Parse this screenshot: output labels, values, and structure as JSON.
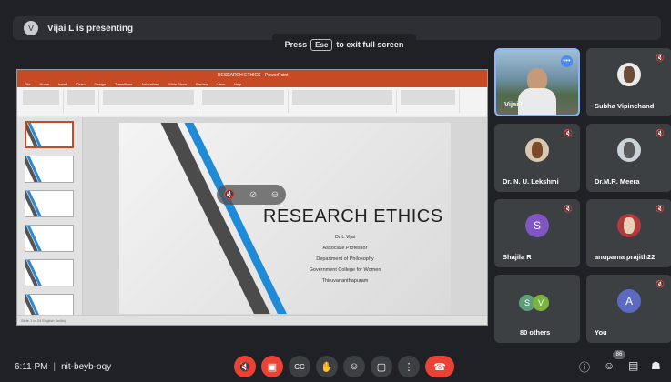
{
  "topbar": {
    "presenter_initial": "V",
    "presenting_text": "Vijai L is presenting"
  },
  "esc_banner": {
    "pre": "Press",
    "key": "Esc",
    "post": "to exit full screen"
  },
  "ppt": {
    "doc_title": "RESEARCH ETHICS - PowerPoint",
    "tabs": [
      "File",
      "Home",
      "Insert",
      "Draw",
      "Design",
      "Transitions",
      "Animations",
      "Slide Show",
      "Review",
      "View",
      "Help"
    ],
    "slide_title": "RESEARCH ETHICS",
    "slide_info": [
      "Dr L Vijai",
      "Associate Professor",
      "Department of Philosophy",
      "Government College for Women",
      "Thiruvananthapuram"
    ],
    "status_text": "Slide 1 of 24    English (India)"
  },
  "participants": [
    {
      "name": "Vijai L",
      "type": "video"
    },
    {
      "name": "Subha Vipinchand",
      "type": "photo"
    },
    {
      "name": "Dr. N. U. Lekshmi",
      "type": "photo"
    },
    {
      "name": "Dr.M.R. Meera",
      "type": "photo"
    },
    {
      "name": "Shajila R",
      "type": "letter",
      "initial": "S",
      "color": "#7e57c2"
    },
    {
      "name": "anupama prajith22",
      "type": "photo"
    },
    {
      "name": "80 others",
      "type": "others",
      "initials": [
        "S",
        "V"
      ]
    },
    {
      "name": "You",
      "type": "letter",
      "initial": "A",
      "color": "#5c6bc0"
    }
  ],
  "bottombar": {
    "time": "6:11 PM",
    "meeting_code": "nit-beyb-oqy",
    "participant_count": "86"
  },
  "icons": {
    "mic_off": "mic-off-icon",
    "cam_off": "camera-off-icon",
    "cc": "captions-icon",
    "hand": "raise-hand-icon",
    "emoji": "emoji-icon",
    "present": "present-icon",
    "more": "more-options-icon",
    "end": "end-call-icon",
    "info": "info-icon",
    "people": "people-icon",
    "chat": "chat-icon",
    "activities": "activities-icon"
  },
  "colors": {
    "end_call": "#ea4335",
    "accent": "#8ab4f8",
    "ppt_orange": "#c64a24"
  }
}
